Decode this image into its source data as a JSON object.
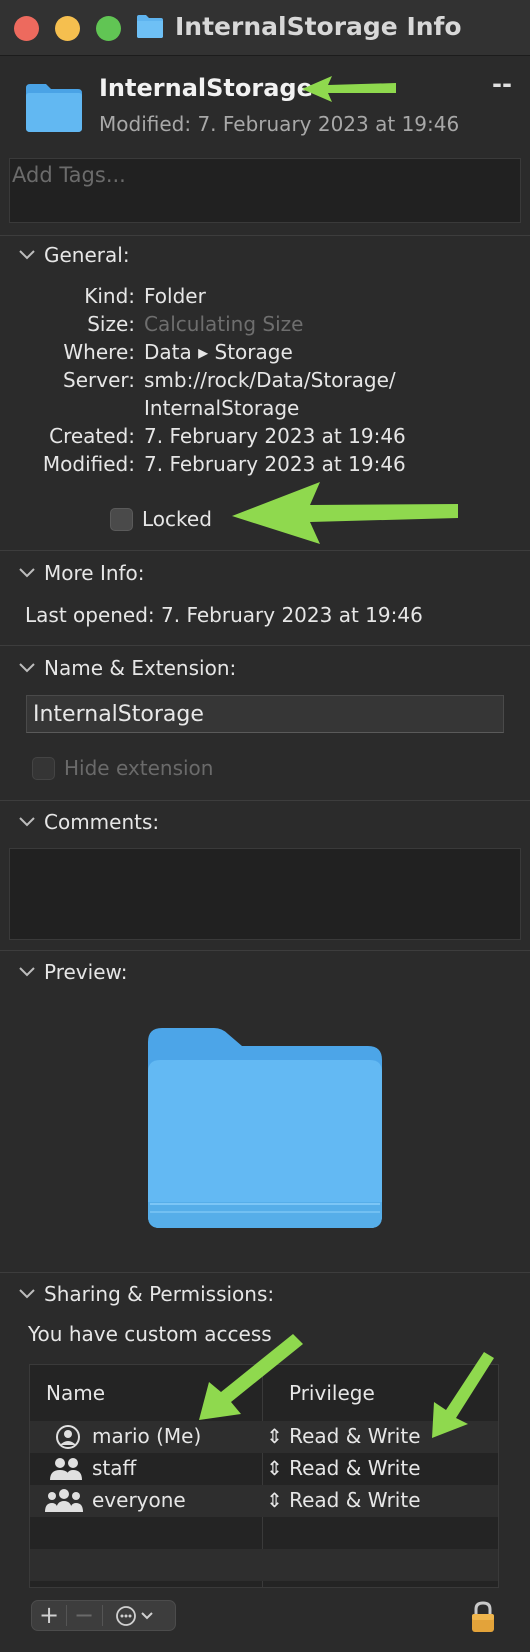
{
  "window": {
    "title": "InternalStorage Info",
    "traffic_lights": {
      "close": "#ed6a5e",
      "minimize": "#f5bf4f",
      "zoom": "#61c554"
    }
  },
  "header": {
    "name": "InternalStorage",
    "modified": "Modified: 7. February 2023 at 19:46",
    "size_short": "--",
    "tags_placeholder": "Add Tags..."
  },
  "general": {
    "title": "General:",
    "rows": [
      {
        "label": "Kind:",
        "value": "Folder"
      },
      {
        "label": "Size:",
        "value": "Calculating Size"
      },
      {
        "label": "Where:",
        "value": "Data ▸ Storage"
      },
      {
        "label": "Server:",
        "value": "smb://rock/Data/Storage/",
        "value2": "InternalStorage"
      },
      {
        "label": "Created:",
        "value": "7. February 2023 at 19:46"
      },
      {
        "label": "Modified:",
        "value": "7. February 2023 at 19:46"
      }
    ],
    "locked_label": "Locked",
    "locked": false
  },
  "more_info": {
    "title": "More Info:",
    "last_opened": "Last opened: 7. February 2023 at 19:46"
  },
  "name_extension": {
    "title": "Name & Extension:",
    "value": "InternalStorage",
    "hide_extension_label": "Hide extension"
  },
  "comments": {
    "title": "Comments:",
    "value": ""
  },
  "preview": {
    "title": "Preview:",
    "folder_color": "#5fb4ef"
  },
  "sharing": {
    "title": "Sharing & Permissions:",
    "access_text": "You have custom access",
    "columns": {
      "name": "Name",
      "privilege": "Privilege"
    },
    "rows": [
      {
        "icon": "user-icon",
        "name": "mario (Me)",
        "privilege": "Read & Write"
      },
      {
        "icon": "group-icon",
        "name": "staff",
        "privilege": "Read & Write"
      },
      {
        "icon": "everyone-icon",
        "name": "everyone",
        "privilege": "Read & Write"
      }
    ],
    "buttons": {
      "add": "+",
      "remove": "−",
      "action": "⋯"
    }
  },
  "annotations": {
    "arrow_color": "#8fd94e"
  }
}
